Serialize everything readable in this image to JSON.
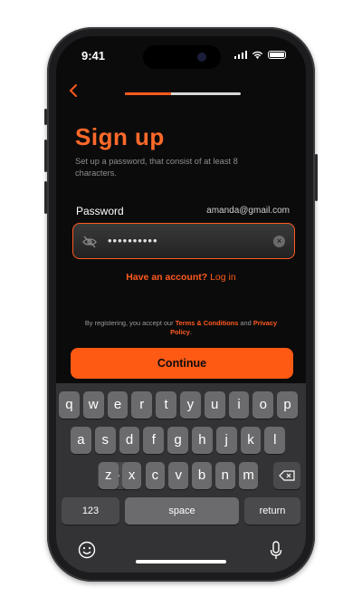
{
  "status_bar": {
    "time": "9:41"
  },
  "header": {
    "back_icon": "chevron-left-icon",
    "progress": 0.4
  },
  "title": "Sign up",
  "subtitle": "Set up a password, that consist of at least 8 characters.",
  "password_label": "Password",
  "email": "amanda@gmail.com",
  "password_value": "••••••••••",
  "account": {
    "question": "Have an account?",
    "link": "Log in"
  },
  "terms": {
    "prefix": "By registering, you accept our ",
    "terms_link": "Terms & Conditions",
    "middle": " and ",
    "privacy_link": "Privacy Policy",
    "suffix": "."
  },
  "continue_label": "Continue",
  "keyboard": {
    "row1": [
      "q",
      "w",
      "e",
      "r",
      "t",
      "y",
      "u",
      "i",
      "o",
      "p"
    ],
    "row2": [
      "a",
      "s",
      "d",
      "f",
      "g",
      "h",
      "j",
      "k",
      "l"
    ],
    "row3": [
      "z",
      "x",
      "c",
      "v",
      "b",
      "n",
      "m"
    ],
    "numbers": "123",
    "space": "space",
    "return": "return"
  },
  "colors": {
    "accent": "#ff5a1f",
    "background": "#0b0b0b"
  }
}
